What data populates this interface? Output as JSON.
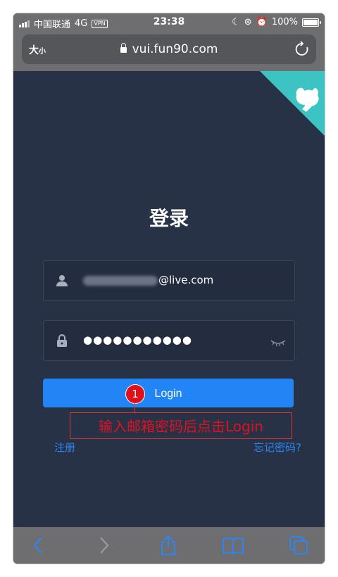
{
  "status": {
    "carrier": "中国联通",
    "network": "4G",
    "vpn": "VPN",
    "time": "23:38",
    "battery": "100%"
  },
  "browser": {
    "text_size": "大",
    "text_size_small": "小",
    "url": "vui.fun90.com"
  },
  "page": {
    "title": "登录",
    "email_suffix": "@live.com",
    "password_mask": "●●●●●●●●●●●",
    "login_label": "Login",
    "register_link": "注册",
    "forgot_link": "忘记密码?"
  },
  "annotation": {
    "step": "1",
    "text": "输入邮箱密码后点击Login"
  },
  "colors": {
    "page_bg": "#283247",
    "primary": "#2185f5",
    "annotation": "#e01020",
    "corner": "#3cc4c4"
  }
}
